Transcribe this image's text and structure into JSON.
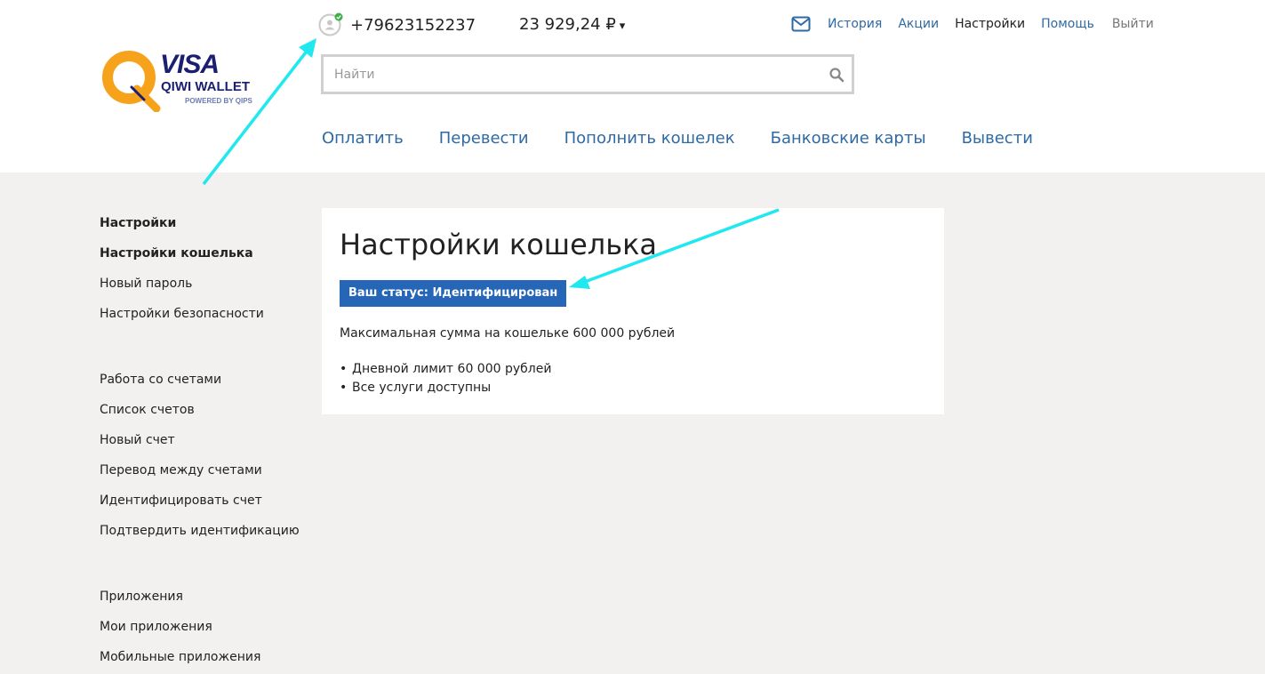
{
  "brand": {
    "visa": "VISA",
    "qiwi_wallet": "QIWI WALLET",
    "powered_by": "POWERED BY QIPS",
    "colors": {
      "orange": "#f7a21b",
      "navy": "#1a1f71",
      "link": "#2e6aa5",
      "badge": "#2566b6",
      "annotation_arrow": "#1fe8ef"
    }
  },
  "header": {
    "phone": "+79623152237",
    "balance": "23 929,24 ₽",
    "balance_arrow": "▾",
    "top_links": {
      "history": "История",
      "promotions": "Акции",
      "settings": "Настройки",
      "help": "Помощь",
      "logout": "Выйти"
    },
    "search": {
      "placeholder": "Найти",
      "value": ""
    },
    "main_nav": {
      "pay": "Оплатить",
      "transfer": "Перевести",
      "top_up": "Пополнить кошелек",
      "bank_cards": "Банковские карты",
      "withdraw": "Вывести"
    }
  },
  "sidebar": {
    "group1": {
      "title": "Настройки",
      "items": [
        "Настройки кошелька",
        "Новый пароль",
        "Настройки безопасности"
      ]
    },
    "group2": {
      "title": "Работа со счетами",
      "items": [
        "Список счетов",
        "Новый счет",
        "Перевод между счетами",
        "Идентифицировать счет",
        "Подтвердить идентификацию"
      ]
    },
    "group3": {
      "title": "Приложения",
      "items": [
        "Мои приложения",
        "Мобильные приложения"
      ]
    }
  },
  "content": {
    "title": "Настройки кошелька",
    "status_badge": "Ваш статус: Идентифицирован",
    "max_sum": "Максимальная сумма на кошельке 600 000 рублей",
    "limits": [
      "Дневной лимит 60 000 рублей",
      "Все услуги доступны"
    ]
  }
}
